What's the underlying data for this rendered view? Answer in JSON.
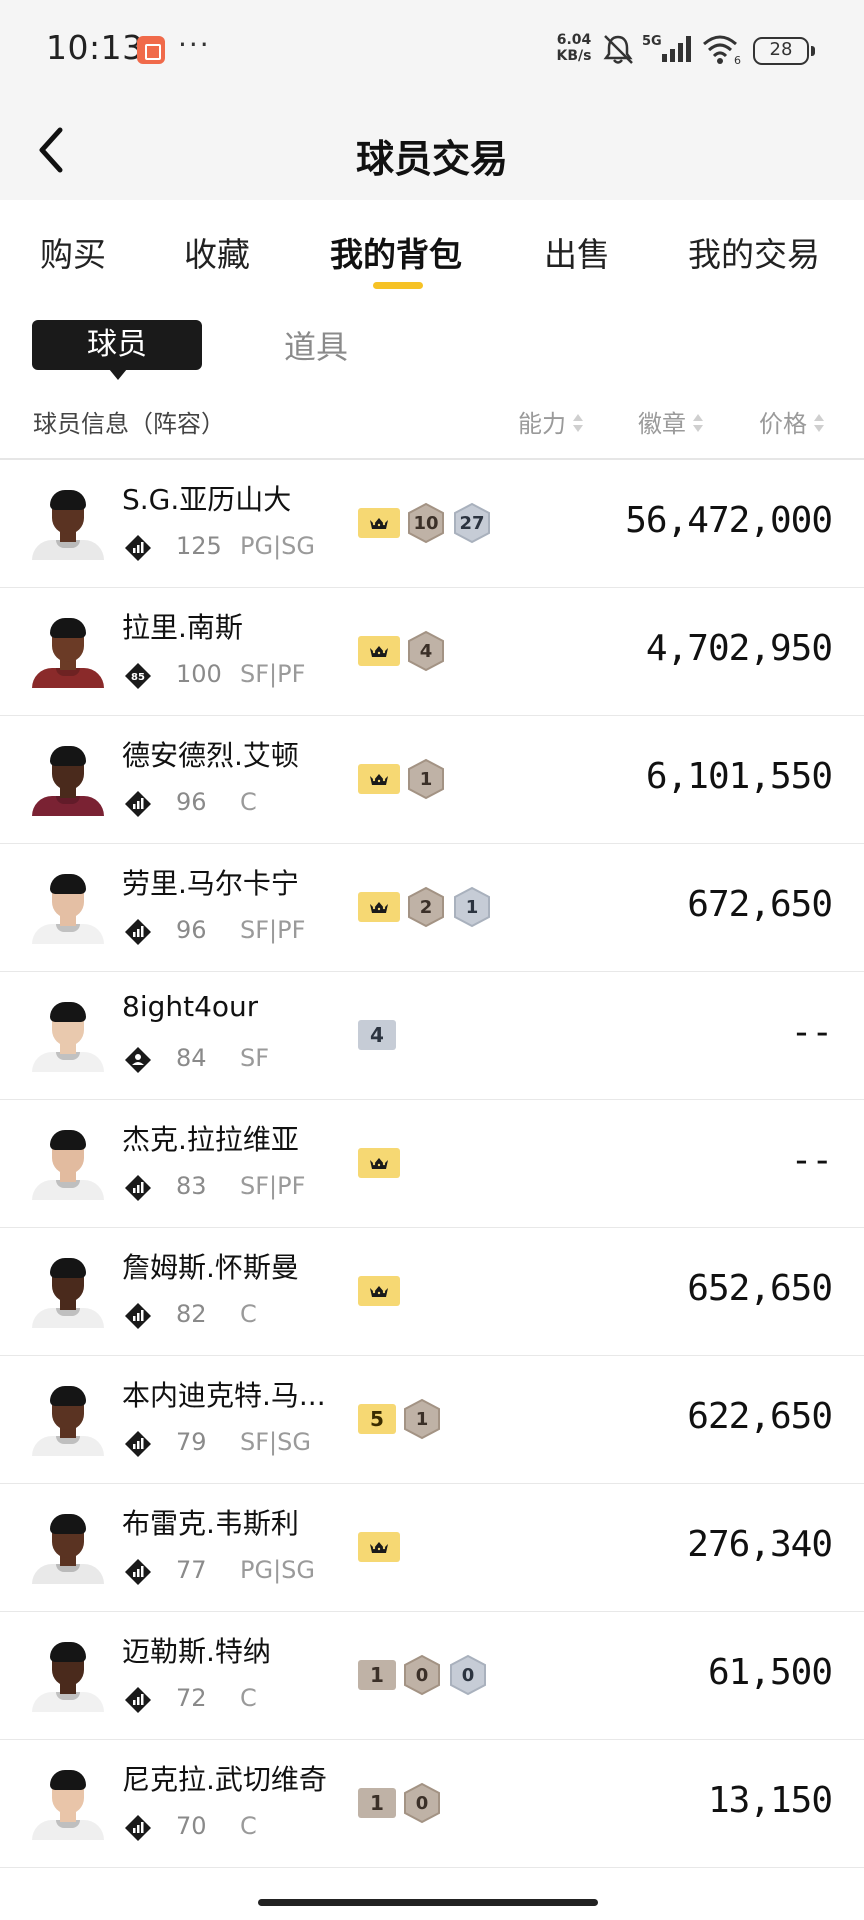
{
  "status_bar": {
    "time": "10:13",
    "dots": "···",
    "speed_value": "6.04",
    "speed_unit": "KB/s",
    "signal_label": "5G",
    "wifi_label": "6",
    "battery": "28",
    "icons": [
      "app-notification-icon",
      "mute-icon",
      "signal-icon",
      "wifi-icon",
      "battery-icon"
    ]
  },
  "header": {
    "title": "球员交易",
    "back_icon": "chevron-left-icon"
  },
  "tabs": [
    {
      "label": "购买",
      "active": false
    },
    {
      "label": "收藏",
      "active": false
    },
    {
      "label": "我的背包",
      "active": true
    },
    {
      "label": "出售",
      "active": false
    },
    {
      "label": "我的交易",
      "active": false
    }
  ],
  "subtabs": [
    {
      "label": "球员",
      "active": true
    },
    {
      "label": "道具",
      "active": false
    }
  ],
  "columns": {
    "info": "球员信息（阵容）",
    "ability": "能力",
    "badge": "徽章",
    "price": "价格"
  },
  "colors": {
    "accent": "#f6c225",
    "crown": "#f6d873",
    "bronze": "#bfb2a6",
    "silver": "#c6ccd6"
  },
  "players": [
    {
      "name": "S.G.亚历山大",
      "ovr": "125",
      "pos": "PG|SG",
      "rank": "bars",
      "crown": true,
      "num_badge": null,
      "hex": [
        {
          "v": "10",
          "t": "bronze"
        },
        {
          "v": "27",
          "t": "silver"
        }
      ],
      "price": "56,472,000",
      "skin": "#5a3322",
      "shirt": "#e9e9e9"
    },
    {
      "name": "拉里.南斯",
      "ovr": "100",
      "pos": "SF|PF",
      "rank": "85",
      "crown": true,
      "num_badge": null,
      "hex": [
        {
          "v": "4",
          "t": "bronze"
        }
      ],
      "price": "4,702,950",
      "skin": "#6b3b26",
      "shirt": "#8a2a2a"
    },
    {
      "name": "德安德烈.艾顿",
      "ovr": "96",
      "pos": "C",
      "rank": "bars",
      "crown": true,
      "num_badge": null,
      "hex": [
        {
          "v": "1",
          "t": "bronze"
        }
      ],
      "price": "6,101,550",
      "skin": "#4a2a1c",
      "shirt": "#7a2233"
    },
    {
      "name": "劳里.马尔卡宁",
      "ovr": "96",
      "pos": "SF|PF",
      "rank": "bars",
      "crown": true,
      "num_badge": null,
      "hex": [
        {
          "v": "2",
          "t": "bronze"
        },
        {
          "v": "1",
          "t": "silver"
        }
      ],
      "price": "672,650",
      "skin": "#e4bfa4",
      "shirt": "#f1f1f1"
    },
    {
      "name": "8ight4our",
      "ovr": "84",
      "pos": "SF",
      "rank": "person",
      "crown": false,
      "num_badge": {
        "v": "4",
        "t": "silver"
      },
      "hex": [],
      "price": "--",
      "skin": "#e9c9ae",
      "shirt": "#f1f1f1"
    },
    {
      "name": "杰克.拉拉维亚",
      "ovr": "83",
      "pos": "SF|PF",
      "rank": "bars",
      "crown": true,
      "num_badge": null,
      "hex": [],
      "price": "--",
      "skin": "#e2bb9f",
      "shirt": "#efefef"
    },
    {
      "name": "詹姆斯.怀斯曼",
      "ovr": "82",
      "pos": "C",
      "rank": "bars",
      "crown": true,
      "num_badge": null,
      "hex": [],
      "price": "652,650",
      "skin": "#4a2a1c",
      "shirt": "#efefef"
    },
    {
      "name": "本内迪克特.马...",
      "ovr": "79",
      "pos": "SF|SG",
      "rank": "bars",
      "crown": false,
      "num_badge": {
        "v": "5",
        "t": "gold"
      },
      "hex": [
        {
          "v": "1",
          "t": "bronze"
        }
      ],
      "price": "622,650",
      "skin": "#5a3322",
      "shirt": "#efefef"
    },
    {
      "name": "布雷克.韦斯利",
      "ovr": "77",
      "pos": "PG|SG",
      "rank": "bars",
      "crown": true,
      "num_badge": null,
      "hex": [],
      "price": "276,340",
      "skin": "#5a3322",
      "shirt": "#e9e9e9"
    },
    {
      "name": "迈勒斯.特纳",
      "ovr": "72",
      "pos": "C",
      "rank": "bars",
      "crown": false,
      "num_badge": {
        "v": "1",
        "t": "bronze"
      },
      "hex": [
        {
          "v": "0",
          "t": "bronze"
        },
        {
          "v": "0",
          "t": "silver"
        }
      ],
      "price": "61,500",
      "skin": "#4a2a1c",
      "shirt": "#f1f1f1"
    },
    {
      "name": "尼克拉.武切维奇",
      "ovr": "70",
      "pos": "C",
      "rank": "bars",
      "crown": false,
      "num_badge": {
        "v": "1",
        "t": "bronze"
      },
      "hex": [
        {
          "v": "0",
          "t": "bronze"
        }
      ],
      "price": "13,150",
      "skin": "#e9c5a9",
      "shirt": "#efefef"
    }
  ]
}
